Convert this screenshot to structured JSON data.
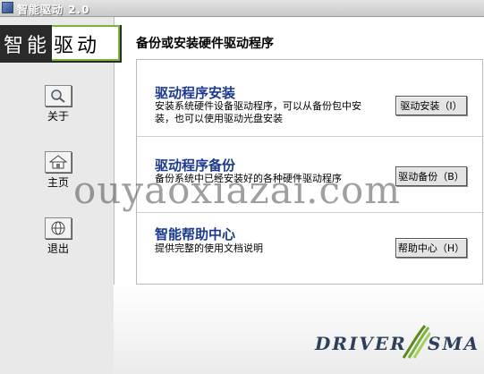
{
  "window": {
    "title": "智能驱动 2.0"
  },
  "logo": {
    "part1": "智能",
    "part2": "驱动"
  },
  "sidebar": {
    "items": [
      {
        "label": "关于",
        "icon": "magnifier-icon"
      },
      {
        "label": "主页",
        "icon": "home-icon"
      },
      {
        "label": "退出",
        "icon": "globe-icon"
      }
    ]
  },
  "main": {
    "heading": "备份或安装硬件驱动程序",
    "sections": [
      {
        "title": "驱动程序安装",
        "description": "安装系统硬件设备驱动程序，可以从备份包中安装，也可以使用驱动光盘安装",
        "button": "驱动安装（I）"
      },
      {
        "title": "驱动程序备份",
        "description": "备份系统中已经安装好的各种硬件驱动程序",
        "button": "驱动备份（B）"
      },
      {
        "title": "智能帮助中心",
        "description": "提供完整的使用文档说明",
        "button": "帮助中心（H）"
      }
    ]
  },
  "watermark": "ouyaoxiazai.com",
  "brand": {
    "part1": "DRIVER",
    "part2": "SMA"
  },
  "colors": {
    "accent": "#1b3a8e",
    "logo_border": "#7ab43c"
  }
}
